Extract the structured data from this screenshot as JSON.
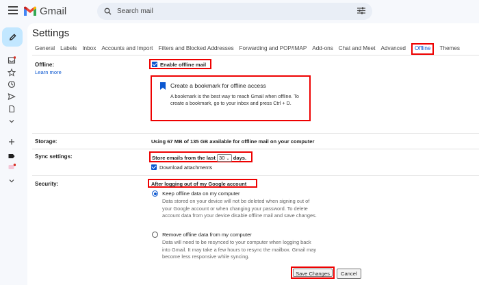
{
  "app": {
    "name": "Gmail"
  },
  "search": {
    "placeholder": "Search mail"
  },
  "page": {
    "title": "Settings"
  },
  "tabs": [
    "General",
    "Labels",
    "Inbox",
    "Accounts and Import",
    "Filters and Blocked Addresses",
    "Forwarding and POP/IMAP",
    "Add-ons",
    "Chat and Meet",
    "Advanced",
    "Offline",
    "Themes"
  ],
  "offline": {
    "label": "Offline:",
    "learn_more": "Learn more",
    "enable_label": "Enable offline mail",
    "bookmark_title": "Create a bookmark for offline access",
    "bookmark_body": "A bookmark is the best way to reach Gmail when offline. To create a bookmark, go to your inbox and press Ctrl + D."
  },
  "storage": {
    "label": "Storage:",
    "text": "Using 67 MB of 135 GB available for offline mail on your computer"
  },
  "sync": {
    "label": "Sync settings:",
    "prefix": "Store emails from the last",
    "days_value": "30",
    "suffix": "days.",
    "download_label": "Download attachments"
  },
  "security": {
    "label": "Security:",
    "heading": "After logging out of my Google account",
    "keep_label": "Keep offline data on my computer",
    "keep_desc": "Data stored on your device will not be deleted when signing out of your Google account or when changing your password. To delete account data from your device disable offline mail and save changes.",
    "remove_label": "Remove offline data from my computer",
    "remove_desc": "Data will need to be resynced to your computer when logging back into Gmail. It may take a few hours to resync the mailbox. Gmail may become less responsive while syncing."
  },
  "actions": {
    "save": "Save Changes",
    "cancel": "Cancel"
  },
  "colors": {
    "accent": "#0b57d0",
    "highlight": "#e00000",
    "compose_bg": "#c2e7ff",
    "page_bg": "#f6f8fc"
  }
}
